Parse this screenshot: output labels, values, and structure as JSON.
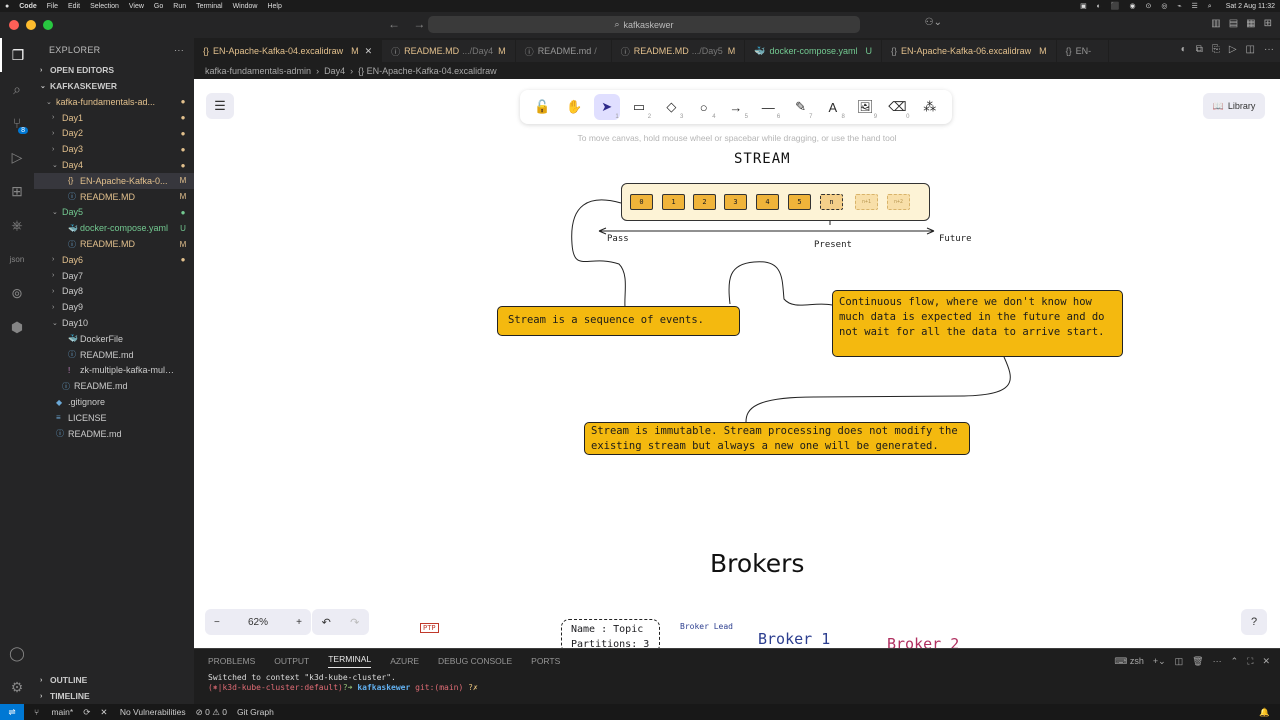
{
  "mac_menu": {
    "app": "Code",
    "items": [
      "File",
      "Edit",
      "Selection",
      "View",
      "Go",
      "Run",
      "Terminal",
      "Window",
      "Help"
    ],
    "clock": "Sat 2 Aug 11:32"
  },
  "titlebar": {
    "search": "kafkaskewer"
  },
  "activity": {
    "scm_badge": "8"
  },
  "explorer": {
    "header": "EXPLORER",
    "open_editors": "OPEN EDITORS",
    "root": "KAFKASKEWER",
    "tree": [
      {
        "label": "kafka-fundamentals-ad...",
        "indent": 1,
        "type": "folder-open",
        "status": "●",
        "status_class": "c-mod"
      },
      {
        "label": "Day1",
        "indent": 2,
        "type": "folder",
        "status": "●",
        "status_class": "c-mod"
      },
      {
        "label": "Day2",
        "indent": 2,
        "type": "folder",
        "status": "●",
        "status_class": "c-mod"
      },
      {
        "label": "Day3",
        "indent": 2,
        "type": "folder",
        "status": "●",
        "status_class": "c-mod"
      },
      {
        "label": "Day4",
        "indent": 2,
        "type": "folder-open",
        "status": "●",
        "status_class": "c-mod"
      },
      {
        "label": "EN-Apache-Kafka-0...",
        "indent": 3,
        "type": "excalidraw",
        "status": "M",
        "status_class": "c-mod",
        "selected": true
      },
      {
        "label": "README.MD",
        "indent": 3,
        "type": "info",
        "status": "M",
        "status_class": "c-mod"
      },
      {
        "label": "Day5",
        "indent": 2,
        "type": "folder-open",
        "status": "●",
        "status_class": "c-unt"
      },
      {
        "label": "docker-compose.yaml",
        "indent": 3,
        "type": "docker",
        "status": "U",
        "status_class": "c-unt"
      },
      {
        "label": "README.MD",
        "indent": 3,
        "type": "info",
        "status": "M",
        "status_class": "c-mod"
      },
      {
        "label": "Day6",
        "indent": 2,
        "type": "folder",
        "status": "●",
        "status_class": "c-mod"
      },
      {
        "label": "Day7",
        "indent": 2,
        "type": "folder",
        "status": "",
        "status_class": ""
      },
      {
        "label": "Day8",
        "indent": 2,
        "type": "folder",
        "status": "",
        "status_class": ""
      },
      {
        "label": "Day9",
        "indent": 2,
        "type": "folder",
        "status": "",
        "status_class": ""
      },
      {
        "label": "Day10",
        "indent": 2,
        "type": "folder-open",
        "status": "",
        "status_class": ""
      },
      {
        "label": "DockerFile",
        "indent": 3,
        "type": "docker",
        "status": "",
        "status_class": ""
      },
      {
        "label": "README.md",
        "indent": 3,
        "type": "info",
        "status": "",
        "status_class": ""
      },
      {
        "label": "zk-multiple-kafka-multipl...",
        "indent": 3,
        "type": "yaml",
        "status": "",
        "status_class": ""
      },
      {
        "label": "README.md",
        "indent": 2,
        "type": "info",
        "status": "",
        "status_class": ""
      },
      {
        "label": ".gitignore",
        "indent": 1,
        "type": "git",
        "status": "",
        "status_class": ""
      },
      {
        "label": "LICENSE",
        "indent": 1,
        "type": "license",
        "status": "",
        "status_class": ""
      },
      {
        "label": "README.md",
        "indent": 1,
        "type": "info",
        "status": "",
        "status_class": ""
      }
    ],
    "outline": "OUTLINE",
    "timeline": "TIMELINE"
  },
  "tabs": [
    {
      "label": "EN-Apache-Kafka-04.excalidraw",
      "desc": "",
      "badge": "M",
      "active": true,
      "icon": "{}"
    },
    {
      "label": "README.MD",
      "desc": ".../Day4",
      "badge": "M",
      "active": false,
      "icon": "ⓘ"
    },
    {
      "label": "README.md",
      "desc": "/",
      "badge": "",
      "active": false,
      "icon": "ⓘ"
    },
    {
      "label": "README.MD",
      "desc": ".../Day5",
      "badge": "M",
      "active": false,
      "icon": "ⓘ"
    },
    {
      "label": "docker-compose.yaml",
      "desc": "",
      "badge": "U",
      "active": false,
      "icon": "🐳"
    },
    {
      "label": "EN-Apache-Kafka-06.excalidraw",
      "desc": "",
      "badge": "M",
      "active": false,
      "icon": "{}"
    },
    {
      "label": "EN-",
      "desc": "",
      "badge": "",
      "active": false,
      "icon": "{}"
    }
  ],
  "breadcrumb": [
    "kafka-fundamentals-admin",
    "Day4",
    "{} EN-Apache-Kafka-04.excalidraw"
  ],
  "excalidraw": {
    "library": "Library",
    "hint": "To move canvas, hold mouse wheel or spacebar while dragging, or use the hand tool",
    "tools": [
      {
        "name": "lock-tool",
        "glyph": "🔓",
        "key": ""
      },
      {
        "name": "hand-tool",
        "glyph": "✋",
        "key": ""
      },
      {
        "name": "selection-tool",
        "glyph": "➤",
        "key": "1",
        "selected": true
      },
      {
        "name": "rectangle-tool",
        "glyph": "▭",
        "key": "2"
      },
      {
        "name": "diamond-tool",
        "glyph": "◇",
        "key": "3"
      },
      {
        "name": "ellipse-tool",
        "glyph": "○",
        "key": "4"
      },
      {
        "name": "arrow-tool",
        "glyph": "→",
        "key": "5"
      },
      {
        "name": "line-tool",
        "glyph": "—",
        "key": "6"
      },
      {
        "name": "draw-tool",
        "glyph": "✎",
        "key": "7"
      },
      {
        "name": "text-tool",
        "glyph": "A",
        "key": "8"
      },
      {
        "name": "image-tool",
        "glyph": "🖼",
        "key": "9"
      },
      {
        "name": "eraser-tool",
        "glyph": "⌫",
        "key": "0"
      },
      {
        "name": "extra-tools",
        "glyph": "⁂",
        "key": ""
      }
    ],
    "stream_title": "STREAM",
    "cells": [
      "0",
      "1",
      "2",
      "3",
      "4",
      "5",
      "n",
      "n+1",
      "n+2"
    ],
    "past": "Pass",
    "present": "Present",
    "future": "Future",
    "note1": "Stream is a sequence of events.",
    "note2": "Continuous flow, where we don't know how much data is expected in the future and do not wait for all the data to arrive start.",
    "note3": "Stream is immutable. Stream processing does not modify the existing stream but always a new one will be generated.",
    "brokers": "Brokers",
    "ptp": "PTP",
    "topic_line1": "Name : Topic",
    "topic_line2": "Partitions: 3",
    "broker_lead": "Broker Lead",
    "broker1": "Broker 1",
    "broker2": "Broker 2",
    "zoom": "62%"
  },
  "panel": {
    "tabs": [
      "PROBLEMS",
      "OUTPUT",
      "TERMINAL",
      "AZURE",
      "DEBUG CONSOLE",
      "PORTS"
    ],
    "active_tab": "TERMINAL",
    "shell": "zsh",
    "line1": "Switched to context \"k3d-kube-cluster\".",
    "prompt_ctx": "(⎈|k3d-kube-cluster:default)",
    "prompt_arrow": "?➜",
    "prompt_dir": "kafkaskewer",
    "prompt_git": "git:(main)",
    "prompt_tail": "?✗"
  },
  "status": {
    "branch": "main*",
    "vuln": "No Vulnerabilities",
    "errors": "⊘ 0 ⚠ 0",
    "git_graph": "Git Graph"
  }
}
